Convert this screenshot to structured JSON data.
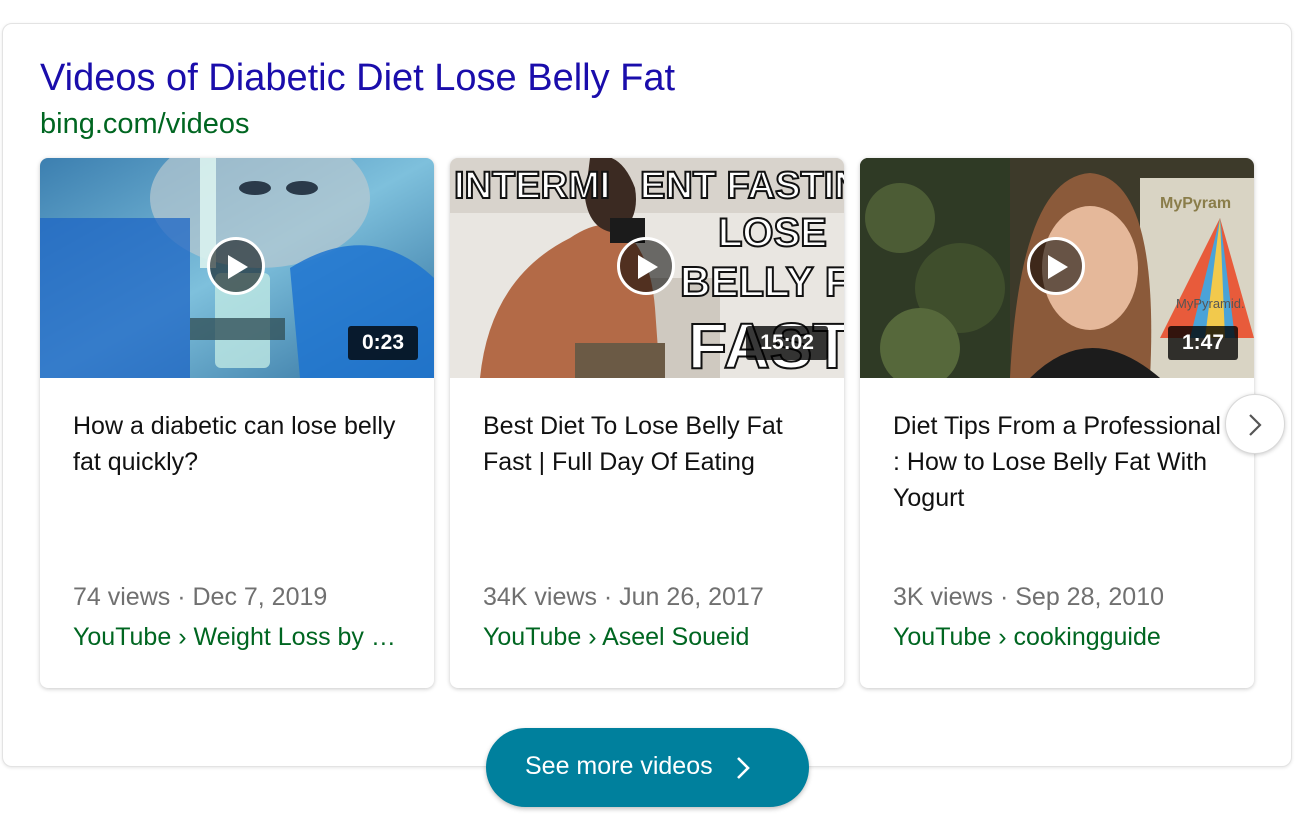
{
  "header": {
    "title": "Videos of Diabetic Diet Lose Belly Fat",
    "source": "bing.com/videos"
  },
  "videos": [
    {
      "duration": "0:23",
      "title": "How a diabetic can lose belly fat quickly?",
      "meta": "74 views · Dec 7, 2019",
      "channel": "YouTube › Weight Loss by …"
    },
    {
      "duration": "15:02",
      "title": "Best Diet To Lose Belly Fat Fast | Full Day Of Eating",
      "meta": "34K views · Jun 26, 2017",
      "channel": "YouTube › Aseel Soueid",
      "thumb_text": [
        "INTERMI",
        "ENT FASTING",
        "LOSE",
        "BELLY FAT",
        "FAST"
      ]
    },
    {
      "duration": "1:47",
      "title": "Diet Tips From a Professional : How to Lose Belly Fat With Yogurt",
      "meta": "3K views · Sep 28, 2010",
      "channel": "YouTube › cookingguide",
      "thumb_text": [
        "MyPyram",
        "MyPyramid."
      ]
    }
  ],
  "controls": {
    "see_more_label": "See more videos",
    "next_icon": "chevron-right-icon",
    "play_icon": "play-icon"
  },
  "colors": {
    "title": "#1a0dab",
    "source": "#006621",
    "button": "#00809d"
  }
}
